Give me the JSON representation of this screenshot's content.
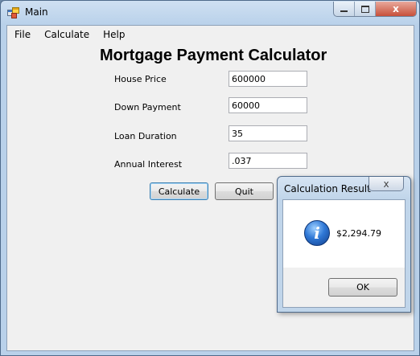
{
  "window": {
    "title": "Main",
    "minimize_glyph": "",
    "close_glyph": "x"
  },
  "menu": {
    "items": [
      "File",
      "Calculate",
      "Help"
    ]
  },
  "form": {
    "heading": "Mortgage Payment Calculator",
    "fields": [
      {
        "label": "House Price",
        "value": "600000"
      },
      {
        "label": "Down Payment",
        "value": "60000"
      },
      {
        "label": "Loan Duration",
        "value": "35"
      },
      {
        "label": "Annual Interest",
        "value": ".037"
      }
    ],
    "calculate_label": "Calculate",
    "quit_label": "Quit"
  },
  "dialog": {
    "title": "Calculation Result",
    "close_glyph": "x",
    "icon": "info-icon",
    "icon_glyph": "i",
    "message": "$2,294.79",
    "ok_label": "OK"
  },
  "icons": {
    "app": "app-window-icon",
    "minimize": "minimize-icon",
    "maximize": "maximize-icon",
    "close": "close-icon"
  },
  "colors": {
    "frame": "#b9d1ea",
    "client": "#f0f0f0",
    "close_button": "#c7503a"
  }
}
